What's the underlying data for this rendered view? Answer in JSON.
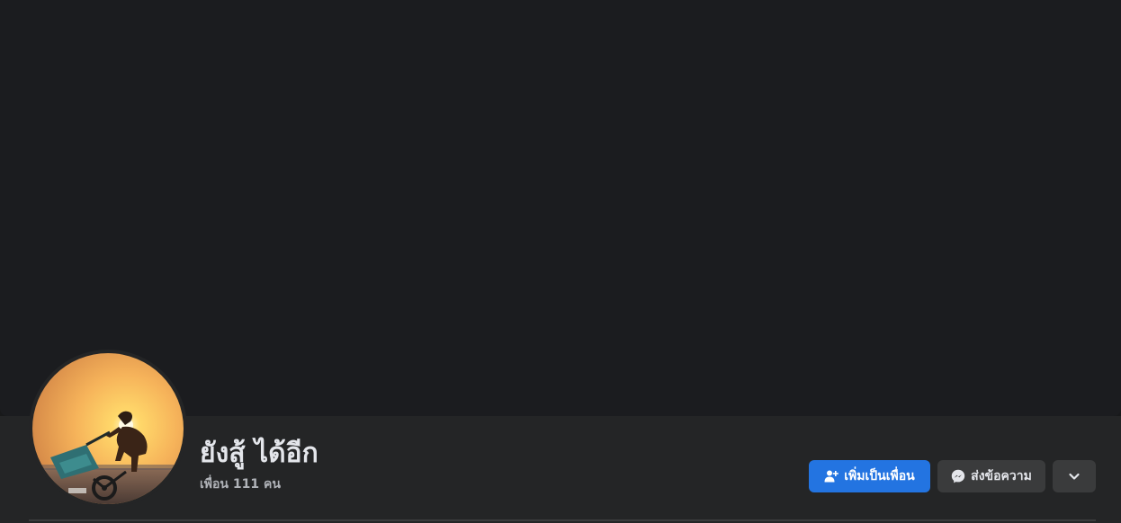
{
  "profile": {
    "name": "ยังสู้ ได้อีก",
    "friend_count": "เพื่อน 111 คน"
  },
  "actions": {
    "add_friend_label": "เพิ่มเป็นเพื่อน",
    "message_label": "ส่งข้อความ",
    "more_icon": "chevron-down-icon"
  },
  "colors": {
    "primary_button": "#2374e1",
    "secondary_button": "#3a3b3c",
    "cover_background": "#1b1c1f",
    "header_background": "#242526",
    "name_text": "#e4e6eb",
    "muted_text": "#b0b3b8"
  }
}
